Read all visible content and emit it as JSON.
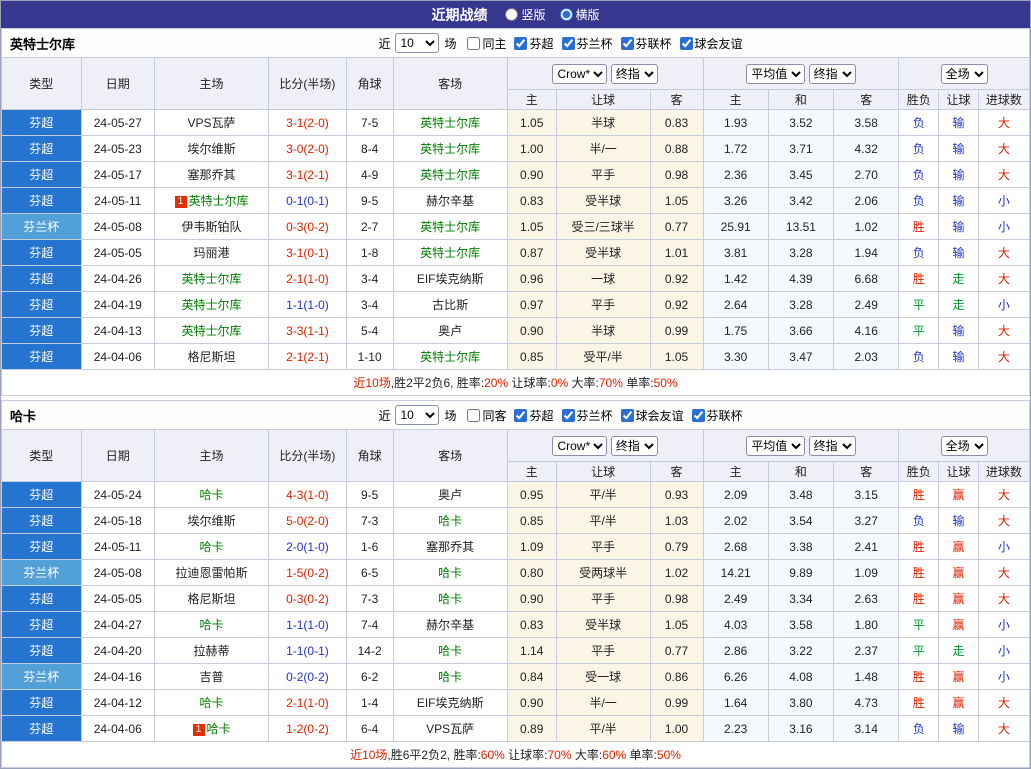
{
  "top_bar": {
    "title": "近期战绩",
    "layout_options": [
      {
        "label": "竖版",
        "selected": false
      },
      {
        "label": "横版",
        "selected": true
      }
    ]
  },
  "columns": {
    "type": "类型",
    "date": "日期",
    "home": "主场",
    "score": "比分(半场)",
    "corner": "角球",
    "away": "客场",
    "odds_home": "主",
    "odds_handicap": "让球",
    "odds_away": "客",
    "avg_home": "主",
    "avg_draw": "和",
    "avg_away": "客",
    "result_wdl": "胜负",
    "result_handicap": "让球",
    "result_goals": "进球数"
  },
  "dropdowns": {
    "bookmaker": "Crow*",
    "final_odds": "终指",
    "average": "平均值",
    "final_odds2": "终指",
    "full_match": "全场"
  },
  "recent_filter": {
    "prefix": "近",
    "count": "10",
    "suffix": "场"
  },
  "badge_text": "1",
  "league_colors": {
    "芬超": "#2474d0",
    "芬兰杯": "#52a0d8"
  },
  "score_colors": {
    "red": "#dd2200",
    "blue": "#2233cc"
  },
  "result_colors": {
    "胜": "#dd2200",
    "赢": "#dd2200",
    "大": "#dd2200",
    "平": "#009933",
    "走": "#009933",
    "负": "#2233cc",
    "输": "#2233cc",
    "小": "#2233cc"
  },
  "tables": [
    {
      "team": "英特士尔库",
      "filters": [
        {
          "label": "同主",
          "checked": false
        },
        {
          "label": "芬超",
          "checked": true
        },
        {
          "label": "芬兰杯",
          "checked": true
        },
        {
          "label": "芬联杯",
          "checked": true
        },
        {
          "label": "球会友谊",
          "checked": true
        }
      ],
      "rows": [
        {
          "league": "芬超",
          "date": "24-05-27",
          "home": "VPS瓦萨",
          "home_self": false,
          "home_badge": false,
          "score": "3-1(2-0)",
          "score_color": "red",
          "corner": "7-5",
          "away": "英特士尔库",
          "away_self": true,
          "away_badge": false,
          "odds": [
            "1.05",
            "半球",
            "0.83"
          ],
          "avg": [
            "1.93",
            "3.52",
            "3.58"
          ],
          "results": [
            "负",
            "输",
            "大"
          ]
        },
        {
          "league": "芬超",
          "date": "24-05-23",
          "home": "埃尔维斯",
          "home_self": false,
          "home_badge": false,
          "score": "3-0(2-0)",
          "score_color": "red",
          "corner": "8-4",
          "away": "英特士尔库",
          "away_self": true,
          "away_badge": false,
          "odds": [
            "1.00",
            "半/一",
            "0.88"
          ],
          "avg": [
            "1.72",
            "3.71",
            "4.32"
          ],
          "results": [
            "负",
            "输",
            "大"
          ]
        },
        {
          "league": "芬超",
          "date": "24-05-17",
          "home": "塞那乔其",
          "home_self": false,
          "home_badge": false,
          "score": "3-1(2-1)",
          "score_color": "red",
          "corner": "4-9",
          "away": "英特士尔库",
          "away_self": true,
          "away_badge": false,
          "odds": [
            "0.90",
            "平手",
            "0.98"
          ],
          "avg": [
            "2.36",
            "3.45",
            "2.70"
          ],
          "results": [
            "负",
            "输",
            "大"
          ]
        },
        {
          "league": "芬超",
          "date": "24-05-11",
          "home": "英特士尔库",
          "home_self": true,
          "home_badge": true,
          "score": "0-1(0-1)",
          "score_color": "blue",
          "corner": "9-5",
          "away": "赫尔辛基",
          "away_self": false,
          "away_badge": false,
          "odds": [
            "0.83",
            "受半球",
            "1.05"
          ],
          "avg": [
            "3.26",
            "3.42",
            "2.06"
          ],
          "results": [
            "负",
            "输",
            "小"
          ]
        },
        {
          "league": "芬兰杯",
          "date": "24-05-08",
          "home": "伊韦斯铂队",
          "home_self": false,
          "home_badge": false,
          "score": "0-3(0-2)",
          "score_color": "red",
          "corner": "2-7",
          "away": "英特士尔库",
          "away_self": true,
          "away_badge": false,
          "odds": [
            "1.05",
            "受三/三球半",
            "0.77"
          ],
          "avg": [
            "25.91",
            "13.51",
            "1.02"
          ],
          "results": [
            "胜",
            "输",
            "小"
          ]
        },
        {
          "league": "芬超",
          "date": "24-05-05",
          "home": "玛丽港",
          "home_self": false,
          "home_badge": false,
          "score": "3-1(0-1)",
          "score_color": "red",
          "corner": "1-8",
          "away": "英特士尔库",
          "away_self": true,
          "away_badge": false,
          "odds": [
            "0.87",
            "受半球",
            "1.01"
          ],
          "avg": [
            "3.81",
            "3.28",
            "1.94"
          ],
          "results": [
            "负",
            "输",
            "大"
          ]
        },
        {
          "league": "芬超",
          "date": "24-04-26",
          "home": "英特士尔库",
          "home_self": true,
          "home_badge": false,
          "score": "2-1(1-0)",
          "score_color": "red",
          "corner": "3-4",
          "away": "EIF埃克纳斯",
          "away_self": false,
          "away_badge": false,
          "odds": [
            "0.96",
            "一球",
            "0.92"
          ],
          "avg": [
            "1.42",
            "4.39",
            "6.68"
          ],
          "results": [
            "胜",
            "走",
            "大"
          ]
        },
        {
          "league": "芬超",
          "date": "24-04-19",
          "home": "英特士尔库",
          "home_self": true,
          "home_badge": false,
          "score": "1-1(1-0)",
          "score_color": "blue",
          "corner": "3-4",
          "away": "古比斯",
          "away_self": false,
          "away_badge": false,
          "odds": [
            "0.97",
            "平手",
            "0.92"
          ],
          "avg": [
            "2.64",
            "3.28",
            "2.49"
          ],
          "results": [
            "平",
            "走",
            "小"
          ]
        },
        {
          "league": "芬超",
          "date": "24-04-13",
          "home": "英特士尔库",
          "home_self": true,
          "home_badge": false,
          "score": "3-3(1-1)",
          "score_color": "red",
          "corner": "5-4",
          "away": "奥卢",
          "away_self": false,
          "away_badge": false,
          "odds": [
            "0.90",
            "半球",
            "0.99"
          ],
          "avg": [
            "1.75",
            "3.66",
            "4.16"
          ],
          "results": [
            "平",
            "输",
            "大"
          ]
        },
        {
          "league": "芬超",
          "date": "24-04-06",
          "home": "格尼斯坦",
          "home_self": false,
          "home_badge": false,
          "score": "2-1(2-1)",
          "score_color": "red",
          "corner": "1-10",
          "away": "英特士尔库",
          "away_self": true,
          "away_badge": false,
          "odds": [
            "0.85",
            "受平/半",
            "1.05"
          ],
          "avg": [
            "3.30",
            "3.47",
            "2.03"
          ],
          "results": [
            "负",
            "输",
            "大"
          ]
        }
      ],
      "summary": [
        {
          "t": "近10场",
          "c": "#dd2200"
        },
        {
          "t": ",胜2平2负6, 胜率:",
          "c": "#222222"
        },
        {
          "t": "20%",
          "c": "#dd2200"
        },
        {
          "t": " 让球率:",
          "c": "#222222"
        },
        {
          "t": "0%",
          "c": "#dd2200"
        },
        {
          "t": " 大率:",
          "c": "#222222"
        },
        {
          "t": "70%",
          "c": "#dd2200"
        },
        {
          "t": " 单率:",
          "c": "#222222"
        },
        {
          "t": "50%",
          "c": "#dd2200"
        }
      ]
    },
    {
      "team": "哈卡",
      "filters": [
        {
          "label": "同客",
          "checked": false
        },
        {
          "label": "芬超",
          "checked": true
        },
        {
          "label": "芬兰杯",
          "checked": true
        },
        {
          "label": "球会友谊",
          "checked": true
        },
        {
          "label": "芬联杯",
          "checked": true
        }
      ],
      "rows": [
        {
          "league": "芬超",
          "date": "24-05-24",
          "home": "哈卡",
          "home_self": true,
          "home_badge": false,
          "score": "4-3(1-0)",
          "score_color": "red",
          "corner": "9-5",
          "away": "奥卢",
          "away_self": false,
          "away_badge": false,
          "odds": [
            "0.95",
            "平/半",
            "0.93"
          ],
          "avg": [
            "2.09",
            "3.48",
            "3.15"
          ],
          "results": [
            "胜",
            "赢",
            "大"
          ]
        },
        {
          "league": "芬超",
          "date": "24-05-18",
          "home": "埃尔维斯",
          "home_self": false,
          "home_badge": false,
          "score": "5-0(2-0)",
          "score_color": "red",
          "corner": "7-3",
          "away": "哈卡",
          "away_self": true,
          "away_badge": false,
          "odds": [
            "0.85",
            "平/半",
            "1.03"
          ],
          "avg": [
            "2.02",
            "3.54",
            "3.27"
          ],
          "results": [
            "负",
            "输",
            "大"
          ]
        },
        {
          "league": "芬超",
          "date": "24-05-11",
          "home": "哈卡",
          "home_self": true,
          "home_badge": false,
          "score": "2-0(1-0)",
          "score_color": "blue",
          "corner": "1-6",
          "away": "塞那乔其",
          "away_self": false,
          "away_badge": false,
          "odds": [
            "1.09",
            "平手",
            "0.79"
          ],
          "avg": [
            "2.68",
            "3.38",
            "2.41"
          ],
          "results": [
            "胜",
            "赢",
            "小"
          ]
        },
        {
          "league": "芬兰杯",
          "date": "24-05-08",
          "home": "拉迪恩雷帕斯",
          "home_self": false,
          "home_badge": false,
          "score": "1-5(0-2)",
          "score_color": "red",
          "corner": "6-5",
          "away": "哈卡",
          "away_self": true,
          "away_badge": false,
          "odds": [
            "0.80",
            "受两球半",
            "1.02"
          ],
          "avg": [
            "14.21",
            "9.89",
            "1.09"
          ],
          "results": [
            "胜",
            "赢",
            "大"
          ]
        },
        {
          "league": "芬超",
          "date": "24-05-05",
          "home": "格尼斯坦",
          "home_self": false,
          "home_badge": false,
          "score": "0-3(0-2)",
          "score_color": "red",
          "corner": "7-3",
          "away": "哈卡",
          "away_self": true,
          "away_badge": false,
          "odds": [
            "0.90",
            "平手",
            "0.98"
          ],
          "avg": [
            "2.49",
            "3.34",
            "2.63"
          ],
          "results": [
            "胜",
            "赢",
            "大"
          ]
        },
        {
          "league": "芬超",
          "date": "24-04-27",
          "home": "哈卡",
          "home_self": true,
          "home_badge": false,
          "score": "1-1(1-0)",
          "score_color": "blue",
          "corner": "7-4",
          "away": "赫尔辛基",
          "away_self": false,
          "away_badge": false,
          "odds": [
            "0.83",
            "受半球",
            "1.05"
          ],
          "avg": [
            "4.03",
            "3.58",
            "1.80"
          ],
          "results": [
            "平",
            "赢",
            "小"
          ]
        },
        {
          "league": "芬超",
          "date": "24-04-20",
          "home": "拉赫蒂",
          "home_self": false,
          "home_badge": false,
          "score": "1-1(0-1)",
          "score_color": "blue",
          "corner": "14-2",
          "away": "哈卡",
          "away_self": true,
          "away_badge": false,
          "odds": [
            "1.14",
            "平手",
            "0.77"
          ],
          "avg": [
            "2.86",
            "3.22",
            "2.37"
          ],
          "results": [
            "平",
            "走",
            "小"
          ]
        },
        {
          "league": "芬兰杯",
          "date": "24-04-16",
          "home": "吉普",
          "home_self": false,
          "home_badge": false,
          "score": "0-2(0-2)",
          "score_color": "blue",
          "corner": "6-2",
          "away": "哈卡",
          "away_self": true,
          "away_badge": false,
          "odds": [
            "0.84",
            "受一球",
            "0.86"
          ],
          "avg": [
            "6.26",
            "4.08",
            "1.48"
          ],
          "results": [
            "胜",
            "赢",
            "小"
          ]
        },
        {
          "league": "芬超",
          "date": "24-04-12",
          "home": "哈卡",
          "home_self": true,
          "home_badge": false,
          "score": "2-1(1-0)",
          "score_color": "red",
          "corner": "1-4",
          "away": "EIF埃克纳斯",
          "away_self": false,
          "away_badge": false,
          "odds": [
            "0.90",
            "半/一",
            "0.99"
          ],
          "avg": [
            "1.64",
            "3.80",
            "4.73"
          ],
          "results": [
            "胜",
            "赢",
            "大"
          ]
        },
        {
          "league": "芬超",
          "date": "24-04-06",
          "home": "哈卡",
          "home_self": true,
          "home_badge": true,
          "score": "1-2(0-2)",
          "score_color": "red",
          "corner": "6-4",
          "away": "VPS瓦萨",
          "away_self": false,
          "away_badge": false,
          "odds": [
            "0.89",
            "平/半",
            "1.00"
          ],
          "avg": [
            "2.23",
            "3.16",
            "3.14"
          ],
          "results": [
            "负",
            "输",
            "大"
          ]
        }
      ],
      "summary": [
        {
          "t": "近10场",
          "c": "#dd2200"
        },
        {
          "t": ",胜6平2负2, 胜率:",
          "c": "#222222"
        },
        {
          "t": "60%",
          "c": "#dd2200"
        },
        {
          "t": " 让球率:",
          "c": "#222222"
        },
        {
          "t": "70%",
          "c": "#dd2200"
        },
        {
          "t": " 大率:",
          "c": "#222222"
        },
        {
          "t": "60%",
          "c": "#dd2200"
        },
        {
          "t": " 单率:",
          "c": "#222222"
        },
        {
          "t": "50%",
          "c": "#dd2200"
        }
      ]
    }
  ]
}
